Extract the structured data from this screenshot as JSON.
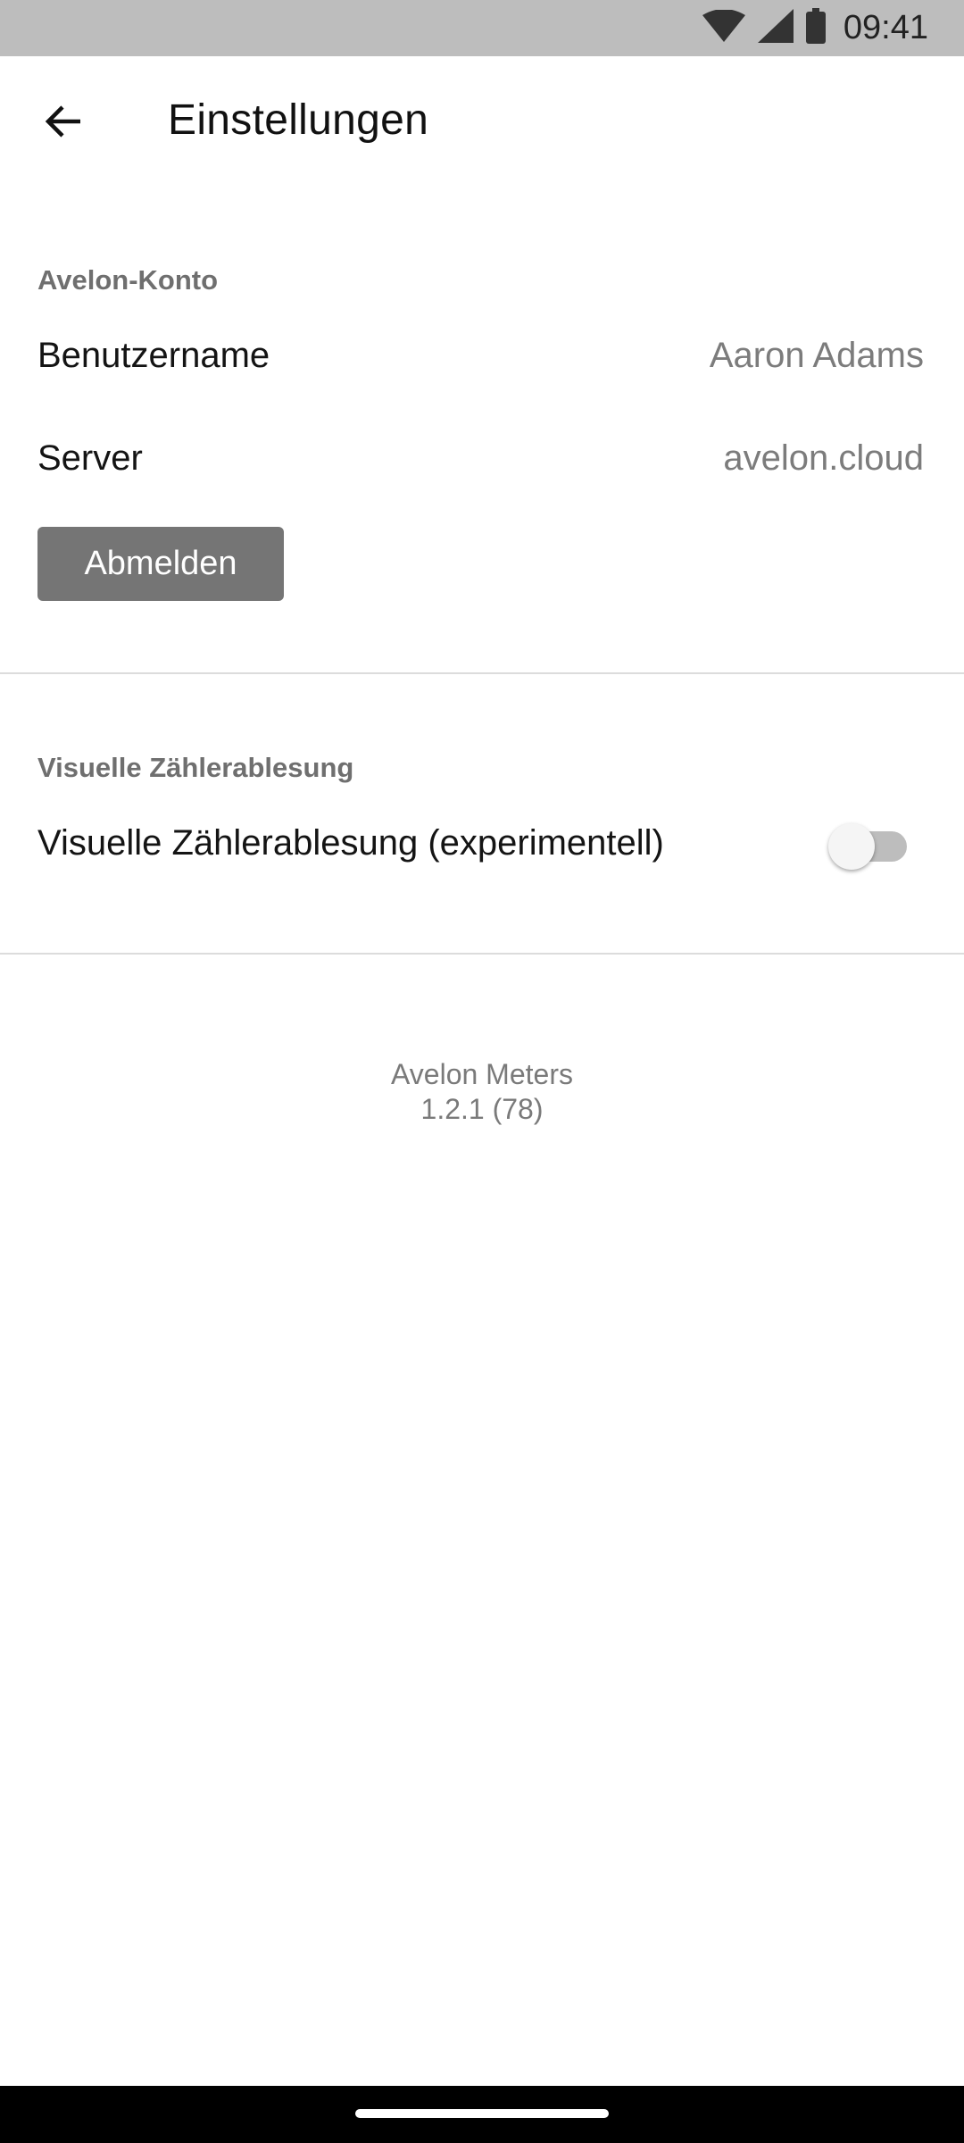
{
  "status_bar": {
    "time": "09:41",
    "icons": [
      "wifi-icon",
      "signal-icon",
      "battery-icon"
    ]
  },
  "app_bar": {
    "back_icon": "arrow-back-icon",
    "title": "Einstellungen"
  },
  "account_section": {
    "header": "Avelon-Konto",
    "username_label": "Benutzername",
    "username_value": "Aaron Adams",
    "server_label": "Server",
    "server_value": "avelon.cloud",
    "logout_label": "Abmelden"
  },
  "visual_section": {
    "header": "Visuelle Zählerablesung",
    "toggle_label": "Visuelle Zählerablesung (experimentell)",
    "toggle_on": false
  },
  "footer": {
    "app_name": "Avelon Meters",
    "version": "1.2.1 (78)"
  },
  "colors": {
    "status_bar": "#bdbdbd",
    "button": "#757575",
    "secondary_text": "#7c7c7c",
    "nav_bar": "#000000"
  }
}
